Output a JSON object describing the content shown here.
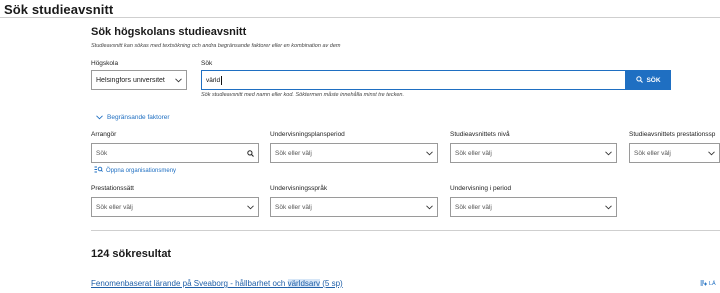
{
  "page": {
    "title": "Sök studieavsnitt"
  },
  "search_section": {
    "title": "Sök högskolans studieavsnitt",
    "subtitle": "Studieavsnitt kan sökas med textsökning och andra begränsande faktorer eller en kombination av dem",
    "university_label": "Högskola",
    "university_value": "Helsingfors universitet",
    "search_label": "Sök",
    "search_value": "värld",
    "search_button_label": "SÖK",
    "hint": "Sök studieavsnitt med namn eller kod. Söktermen måste innehålla minst tre tecken."
  },
  "filters": {
    "toggle_label": "Begränsande faktorer",
    "org_link_label": "Öppna organisationsmeny",
    "row1": [
      {
        "label": "Arrangör",
        "placeholder": "Sök",
        "icon": "search-icon"
      },
      {
        "label": "Undervisningsplansperiod",
        "placeholder": "Sök eller välj",
        "icon": "chevron-down-icon"
      },
      {
        "label": "Studieavsnittets nivå",
        "placeholder": "Sök eller välj",
        "icon": "chevron-down-icon"
      },
      {
        "label": "Studieavsnittets prestationssp",
        "placeholder": "Sök eller välj",
        "icon": "chevron-down-icon"
      }
    ],
    "row2": [
      {
        "label": "Prestationssätt",
        "placeholder": "Sök eller välj",
        "icon": "chevron-down-icon"
      },
      {
        "label": "Undervisningsspråk",
        "placeholder": "Sök eller välj",
        "icon": "chevron-down-icon"
      },
      {
        "label": "Undervisning i period",
        "placeholder": "Sök eller välj",
        "icon": "chevron-down-icon"
      }
    ]
  },
  "results": {
    "count_label": "124 sökresultat",
    "items": [
      {
        "title_before": "Fenomenbaserat lärande på Sveaborg - hållbarhet och ",
        "title_highlight": "världsarv",
        "title_after": " (5 sp)",
        "action_label": "LÄ"
      }
    ]
  },
  "colors": {
    "accent": "#1f6fc2",
    "border": "#9a9a9a",
    "highlight": "#d6e6f7"
  }
}
